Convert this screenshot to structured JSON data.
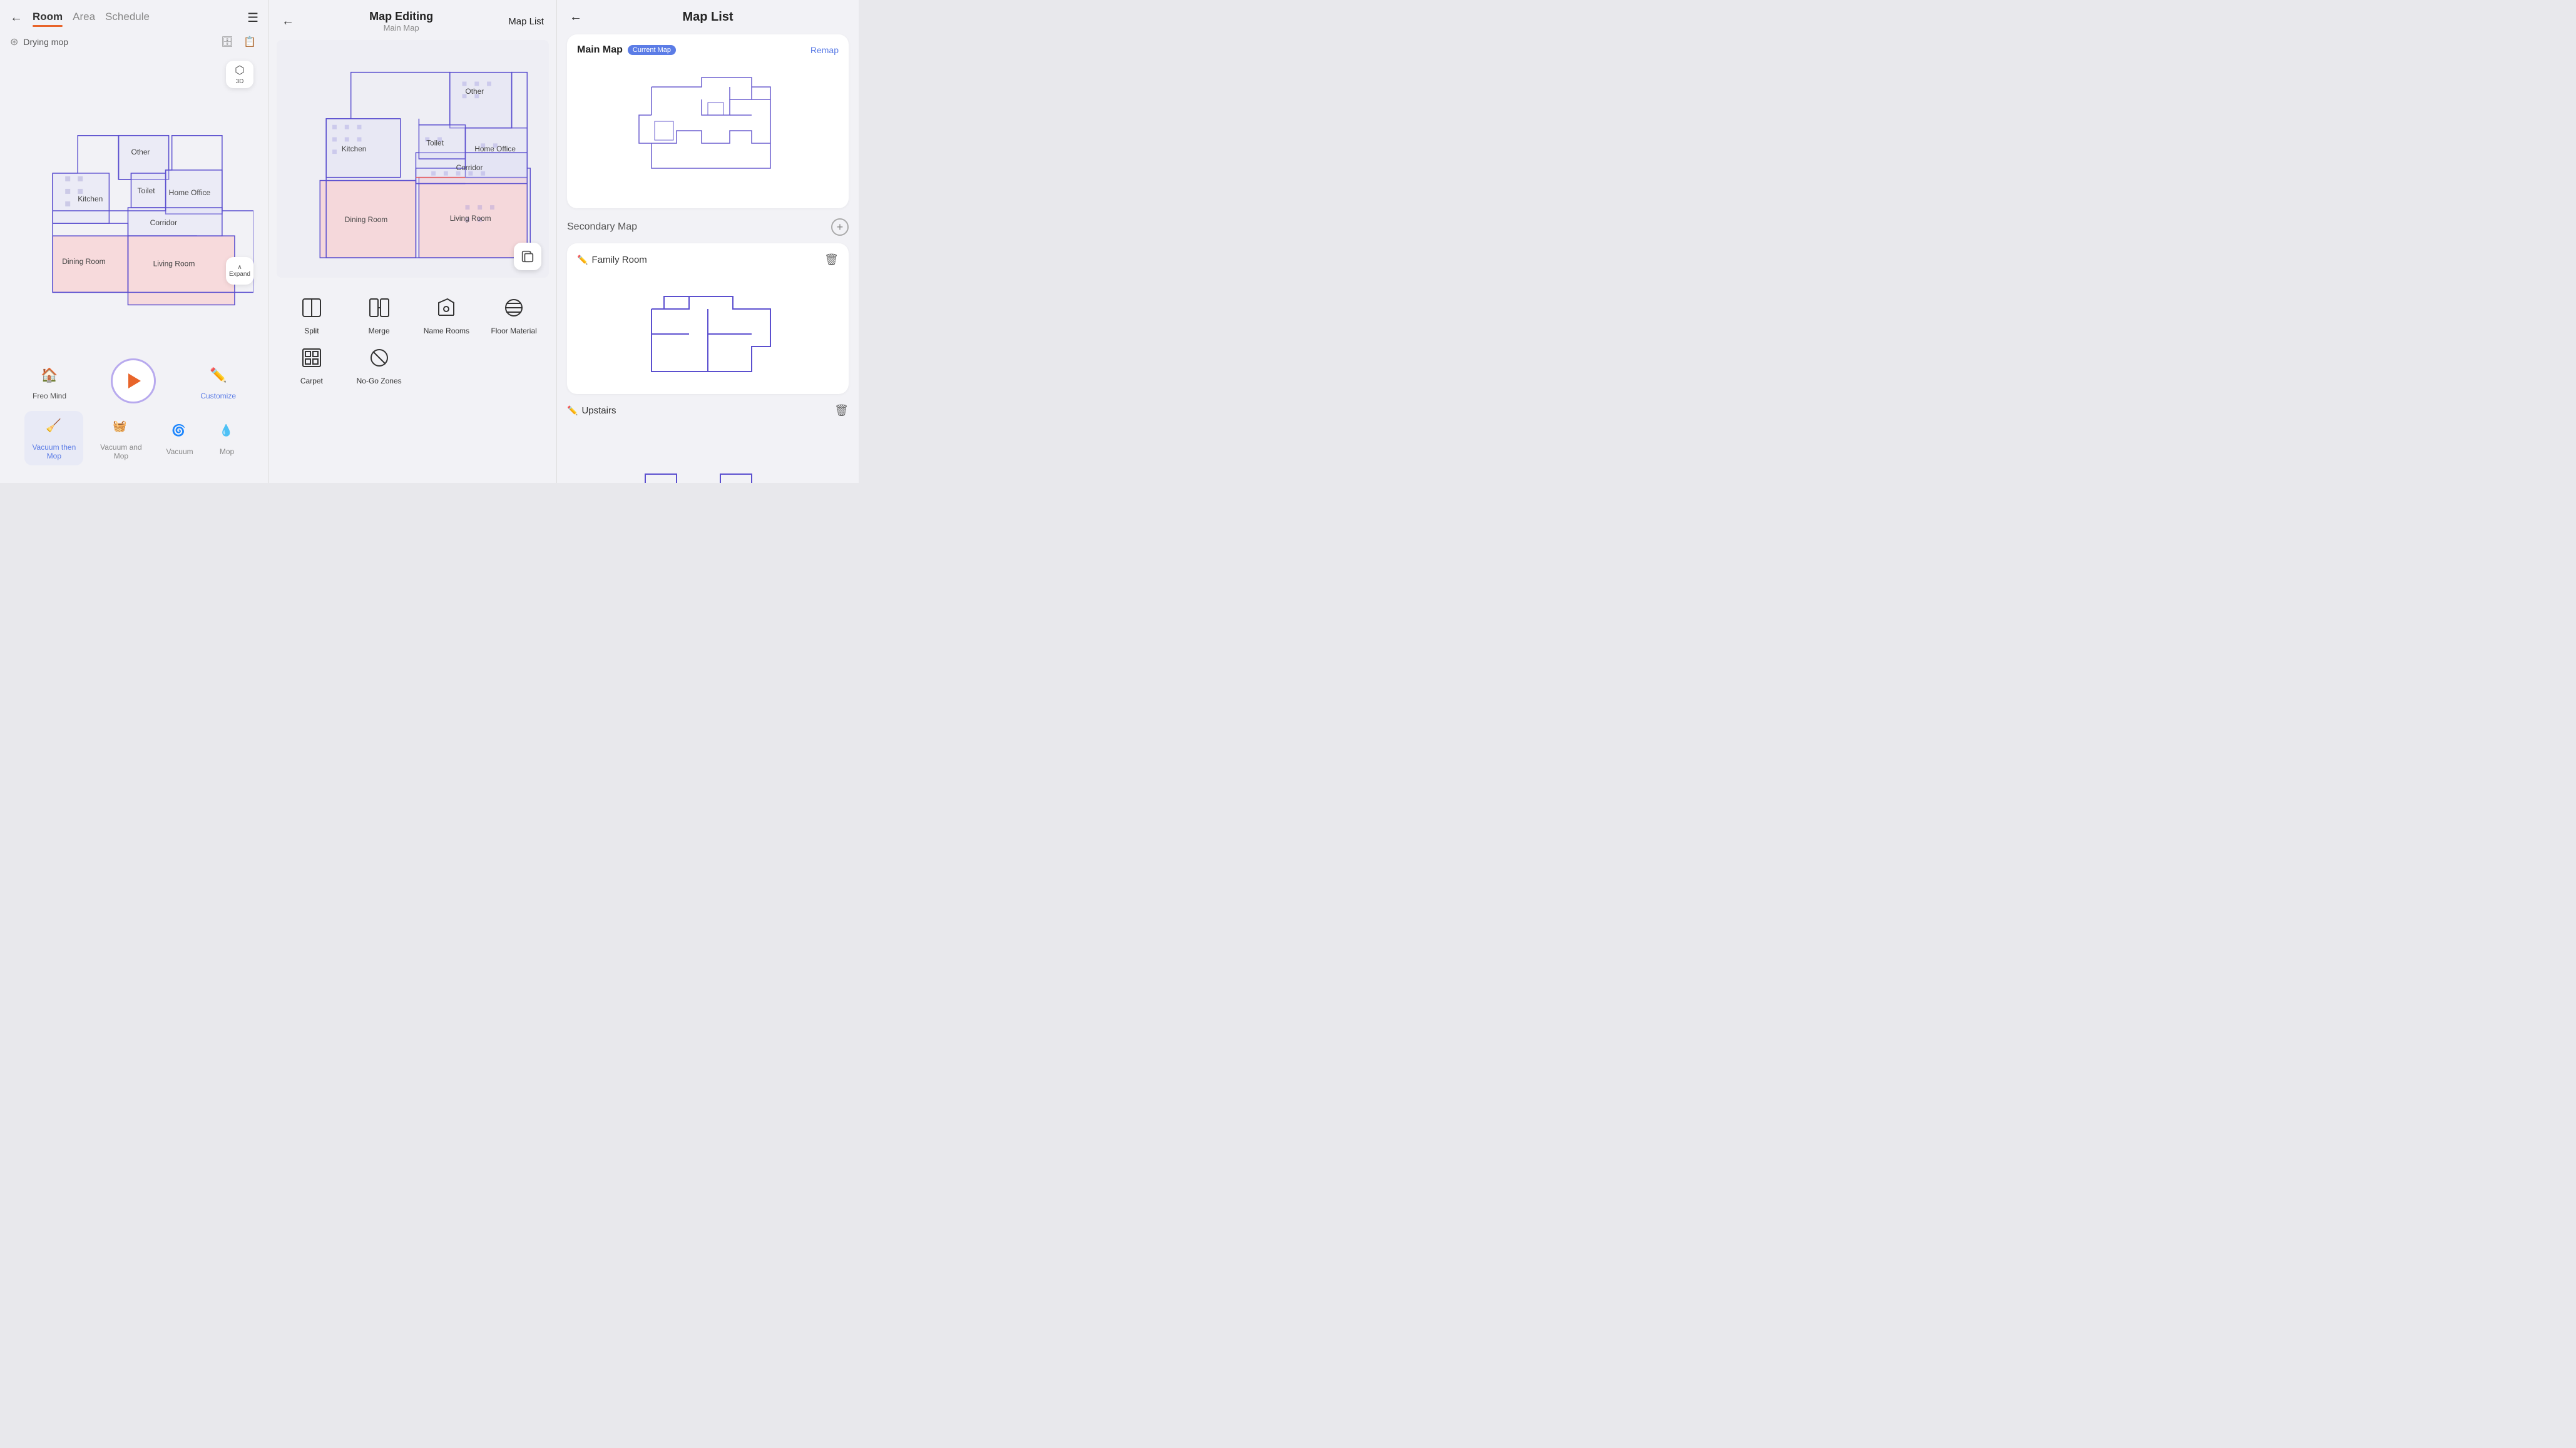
{
  "left": {
    "back_label": "←",
    "tabs": [
      {
        "label": "Room",
        "active": true
      },
      {
        "label": "Area",
        "active": false
      },
      {
        "label": "Schedule",
        "active": false
      }
    ],
    "drying_mop_label": "Drying mop",
    "btn_3d_label": "3D",
    "expand_label": "Expand",
    "freo_mind_label": "Freo Mind",
    "customize_label": "Customize",
    "modes": [
      {
        "icon": "🧹🫧",
        "label": "Vacuum then\nMop",
        "selected": true
      },
      {
        "icon": "🧹💧",
        "label": "Vacuum and\nMop",
        "selected": false
      },
      {
        "icon": "🧹",
        "label": "Vacuum",
        "selected": false
      },
      {
        "icon": "🫧",
        "label": "Mop",
        "selected": false
      }
    ],
    "rooms": [
      {
        "name": "Kitchen"
      },
      {
        "name": "Other"
      },
      {
        "name": "Home Office"
      },
      {
        "name": "Toilet"
      },
      {
        "name": "Corridor"
      },
      {
        "name": "Dining Room"
      },
      {
        "name": "Living Room"
      }
    ]
  },
  "middle": {
    "title": "Map Editing",
    "subtitle": "Main Map",
    "map_list_label": "Map List",
    "back_label": "←",
    "copy_icon": "⊟",
    "tools": [
      {
        "icon": "split",
        "label": "Split"
      },
      {
        "icon": "merge",
        "label": "Merge"
      },
      {
        "icon": "name",
        "label": "Name Rooms"
      },
      {
        "icon": "floor",
        "label": "Floor Material"
      },
      {
        "icon": "carpet",
        "label": "Carpet"
      },
      {
        "icon": "nogo",
        "label": "No-Go Zones"
      }
    ]
  },
  "right": {
    "title": "Map List",
    "back_label": "←",
    "main_map": {
      "label": "Main Map",
      "badge": "Current Map",
      "remap_label": "Remap"
    },
    "secondary_map_label": "Secondary Map",
    "add_btn_label": "+",
    "sub_maps": [
      {
        "name": "Family Room",
        "edit_icon": "✏️",
        "delete_icon": "🗑"
      },
      {
        "name": "Upstairs",
        "edit_icon": "✏️",
        "delete_icon": "🗑"
      }
    ]
  }
}
